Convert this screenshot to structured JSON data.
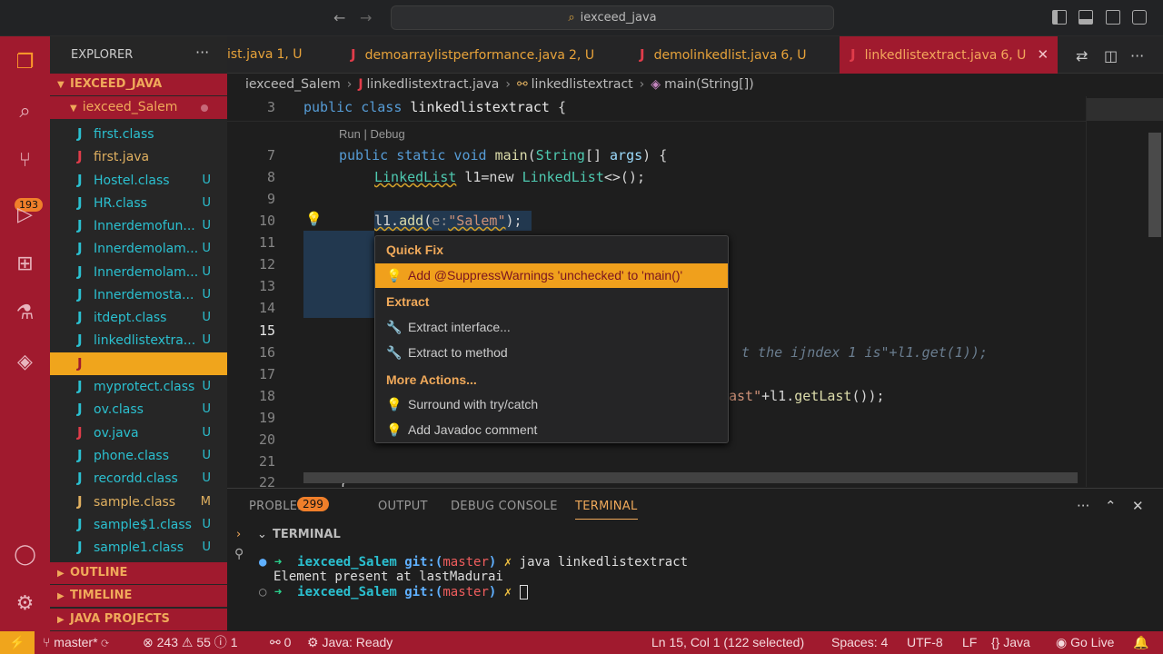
{
  "titlebar": {
    "search": "iexceed_java"
  },
  "activity": {
    "badge": "193"
  },
  "sidebar": {
    "header": "EXPLORER",
    "more": "···",
    "root": "IEXCEED_JAVA",
    "project": "iexceed_Salem",
    "files": [
      {
        "name": "first.class",
        "status": ""
      },
      {
        "name": "first.java",
        "status": ""
      },
      {
        "name": "Hostel.class",
        "status": "U"
      },
      {
        "name": "HR.class",
        "status": "U"
      },
      {
        "name": "Innerdemofun...",
        "status": "U"
      },
      {
        "name": "Innerdemolam...",
        "status": "U"
      },
      {
        "name": "Innerdemolam...",
        "status": "U"
      },
      {
        "name": "Innerdemosta...",
        "status": "U"
      },
      {
        "name": "itdept.class",
        "status": "U"
      },
      {
        "name": "linkedlistextra...",
        "status": "U"
      },
      {
        "name": "",
        "status": ""
      },
      {
        "name": "myprotect.class",
        "status": "U"
      },
      {
        "name": "ov.class",
        "status": "U"
      },
      {
        "name": "ov.java",
        "status": "U"
      },
      {
        "name": "phone.class",
        "status": "U"
      },
      {
        "name": "recordd.class",
        "status": "U"
      },
      {
        "name": "sample.class",
        "status": "M"
      },
      {
        "name": "sample$1.class",
        "status": "U"
      },
      {
        "name": "sample1.class",
        "status": "U"
      }
    ],
    "sections": [
      "OUTLINE",
      "TIMELINE",
      "JAVA PROJECTS"
    ]
  },
  "tabs": [
    {
      "label": "ist.java",
      "status": "1, U"
    },
    {
      "label": "demoarraylistperformance.java",
      "status": "2, U"
    },
    {
      "label": "demolinkedlist.java",
      "status": "6, U"
    },
    {
      "label": "linkedlistextract.java",
      "status": "6, U"
    }
  ],
  "breadcrumb": [
    "iexceed_Salem",
    "linkedlistextract.java",
    "linkedlistextract",
    "main(String[])"
  ],
  "editor": {
    "codelens": "Run | Debug",
    "line_numbers": [
      "3",
      "7",
      "8",
      "9",
      "10",
      "11",
      "12",
      "13",
      "14",
      "15",
      "16",
      "17",
      "18",
      "19",
      "20",
      "21",
      "22"
    ],
    "line3": {
      "kw": "public class",
      "name": "linkedlistextract",
      "rest": " {"
    },
    "line7": {
      "kw1": "public static void",
      "fn": "main",
      "p1": "(",
      "type": "String",
      "p2": "[] ",
      "arg": "args",
      "p3": ") {"
    },
    "line8": {
      "type": "LinkedList",
      "rest": " l1=new ",
      "type2": "LinkedList",
      "rest2": "<>();"
    },
    "line10": {
      "obj": "l1.",
      "fn": "add",
      "p": "(",
      "hint": "e:",
      "str": "\"Salem\"",
      "end": ");"
    },
    "line16": "t the ijndex 1 is\"+l1.get(1));",
    "line18": {
      "str": "ast\"",
      "rest": "+l1.",
      "fn": "getLast",
      "end": "());"
    },
    "line22": "}"
  },
  "quickfix": {
    "header1": "Quick Fix",
    "item1": "Add @SuppressWarnings 'unchecked' to 'main()'",
    "header2": "Extract",
    "item2": "Extract interface...",
    "item3": "Extract to method",
    "header3": "More Actions...",
    "item4": "Surround with try/catch",
    "item5": "Add Javadoc comment"
  },
  "panel": {
    "tabs": [
      "PROBLEMS",
      "OUTPUT",
      "DEBUG CONSOLE",
      "TERMINAL"
    ],
    "problems_count": "299",
    "section": "TERMINAL",
    "terminal": {
      "line1": {
        "dir": "iexceed_Salem",
        "git": "git:(",
        "branch": "master",
        "close": ")",
        "x": "✗",
        "cmd": " java linkedlistextract"
      },
      "line2": "Element present at lastMadurai",
      "line3": {
        "dir": "iexceed_Salem",
        "git": "git:(",
        "branch": "master",
        "close": ")",
        "x": "✗"
      }
    }
  },
  "status": {
    "branch": "master*",
    "errors": "243",
    "warnings": "55",
    "info": "1",
    "ports": "0",
    "java": "Java: Ready",
    "position": "Ln 15, Col 1 (122 selected)",
    "spaces": "Spaces: 4",
    "encoding": "UTF-8",
    "eol": "LF",
    "language": "Java",
    "golive": "Go Live"
  }
}
